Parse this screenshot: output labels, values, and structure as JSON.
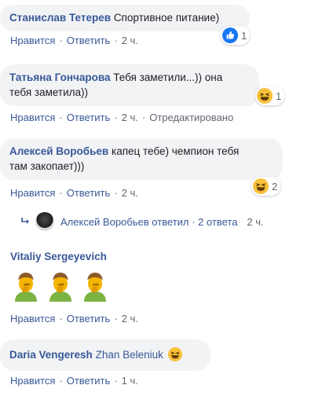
{
  "actions": {
    "like": "Нравится",
    "reply": "Ответить",
    "sep": "·"
  },
  "comments": [
    {
      "author": "Станислав Тетерев",
      "text": "Спортивное питание)",
      "time": "2 ч.",
      "reaction": {
        "icon": "like-icon",
        "count": "1"
      }
    },
    {
      "author": "Татьяна Гончарова",
      "text_line1": "Тебя заметили...)) она",
      "text_line2": "тебя заметила))",
      "time": "2 ч.",
      "edited": "Отредактировано",
      "reaction": {
        "icon": "laughing-emoji-icon",
        "count": "1"
      }
    },
    {
      "author": "Алексей Воробьев",
      "text_line1": "капец тебе) чемпион тебя",
      "text_line2": "там закопает)))",
      "time": "2 ч.",
      "reaction": {
        "icon": "laughing-emoji-icon",
        "count": "2"
      },
      "replies": {
        "text": "Алексей Воробьев ответил · 2 ответа",
        "time": "2 ч."
      }
    },
    {
      "author": "Vitaliy Sergeyevich",
      "stickers": [
        "facepalm-emoji-icon",
        "facepalm-emoji-icon",
        "facepalm-emoji-icon"
      ],
      "time": "2 ч."
    },
    {
      "author": "Daria Vengeresh",
      "text": "Zhan Beleniuk",
      "time": "1 ч."
    }
  ],
  "colors": {
    "link": "#385898",
    "meta": "#606770",
    "bubble": "#f2f3f5",
    "like_blue": "#1877f2",
    "emoji_yellow": "#f7c13b"
  }
}
